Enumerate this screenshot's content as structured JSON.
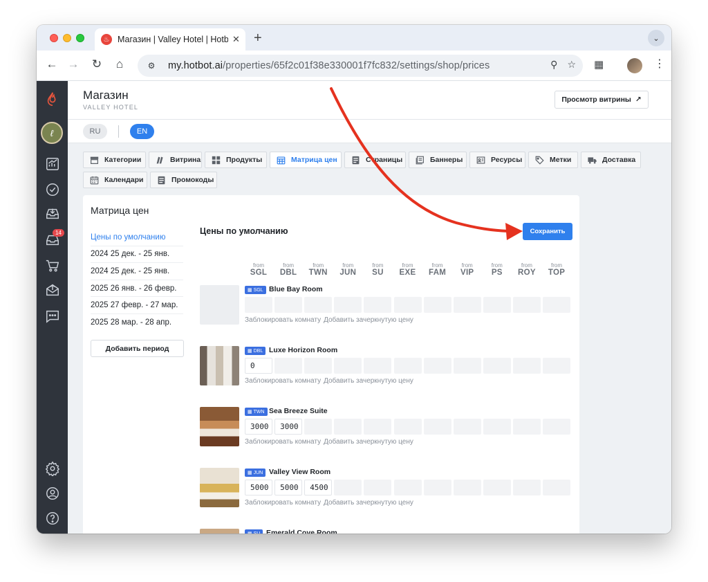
{
  "browser": {
    "tab_title": "Магазин | Valley Hotel | Hotbot",
    "url_host": "my.hotbot.ai",
    "url_path": "/properties/65f2c01f38e330001f7fc832/settings/shop/prices"
  },
  "sidebar": {
    "badge_count": "14",
    "icons": [
      "flame-logo-icon",
      "avatar",
      "analytics-icon",
      "tasks-icon",
      "inbox-icon",
      "notifications-icon",
      "shop-cart-icon",
      "mail-icon",
      "chat-icon",
      "settings-icon",
      "profile-icon",
      "help-icon"
    ]
  },
  "header": {
    "title": "Магазин",
    "subtitle": "VALLEY HOTEL",
    "preview_button": "Просмотр витрины"
  },
  "languages": {
    "ru": "RU",
    "en": "EN",
    "active": "EN"
  },
  "nav_tabs": [
    {
      "label": "Категории",
      "icon": "category-icon"
    },
    {
      "label": "Витрина",
      "icon": "showcase-icon"
    },
    {
      "label": "Продукты",
      "icon": "products-icon"
    },
    {
      "label": "Матрица цен",
      "icon": "price-matrix-icon",
      "active": true
    },
    {
      "label": "Страницы",
      "icon": "pages-icon"
    },
    {
      "label": "Баннеры",
      "icon": "banners-icon"
    },
    {
      "label": "Ресурсы",
      "icon": "resources-icon"
    },
    {
      "label": "Метки",
      "icon": "tags-icon"
    },
    {
      "label": "Доставка",
      "icon": "delivery-icon"
    },
    {
      "label": "Календари",
      "icon": "calendar-icon"
    },
    {
      "label": "Промокоды",
      "icon": "promo-icon"
    }
  ],
  "matrix": {
    "card_title": "Матрица цен",
    "periods": [
      "Цены по умолчанию",
      "2024 25 дек. - 25 янв.",
      "2024 25 дек. - 25 янв.",
      "2025 26 янв. - 26 февр.",
      "2025 27 февр. - 27 мар.",
      "2025 28 мар. - 28 апр."
    ],
    "add_period": "Добавить период",
    "grid_title": "Цены по умолчанию",
    "save_button": "Сохранить",
    "from_label": "from",
    "columns": [
      "SGL",
      "DBL",
      "TWN",
      "JUN",
      "SU",
      "EXE",
      "FAM",
      "VIP",
      "PS",
      "ROY",
      "TOP"
    ],
    "block_room": "Заблокировать комнату",
    "add_strike": "Добавить зачеркнутую цену",
    "rooms": [
      {
        "code": "SGL",
        "name": "Blue Bay Room",
        "prices": [
          "",
          "",
          "",
          "",
          "",
          "",
          "",
          "",
          "",
          "",
          ""
        ],
        "image": "none"
      },
      {
        "code": "DBL",
        "name": "Luxe Horizon Room",
        "prices": [
          "0",
          "",
          "",
          "",
          "",
          "",
          "",
          "",
          "",
          "",
          ""
        ],
        "image": "corridor"
      },
      {
        "code": "TWN",
        "name": "Sea Breeze Suite",
        "prices": [
          "3000",
          "3000",
          "",
          "",
          "",
          "",
          "",
          "",
          "",
          "",
          ""
        ],
        "image": "bedroom-warm"
      },
      {
        "code": "JUN",
        "name": "Valley View Room",
        "prices": [
          "5000",
          "5000",
          "4500",
          "",
          "",
          "",
          "",
          "",
          "",
          "",
          ""
        ],
        "image": "bedroom-yellow"
      },
      {
        "code": "SU",
        "name": "Emerald Cove Room",
        "prices": [
          "",
          "",
          "",
          "",
          "",
          "",
          "",
          "",
          "",
          "",
          ""
        ],
        "image": "partial"
      }
    ]
  },
  "colors": {
    "accent": "#2f80ed",
    "sidebar_bg": "#2f343c",
    "annotation_arrow": "#e5321f",
    "badge": "#e5484d"
  }
}
